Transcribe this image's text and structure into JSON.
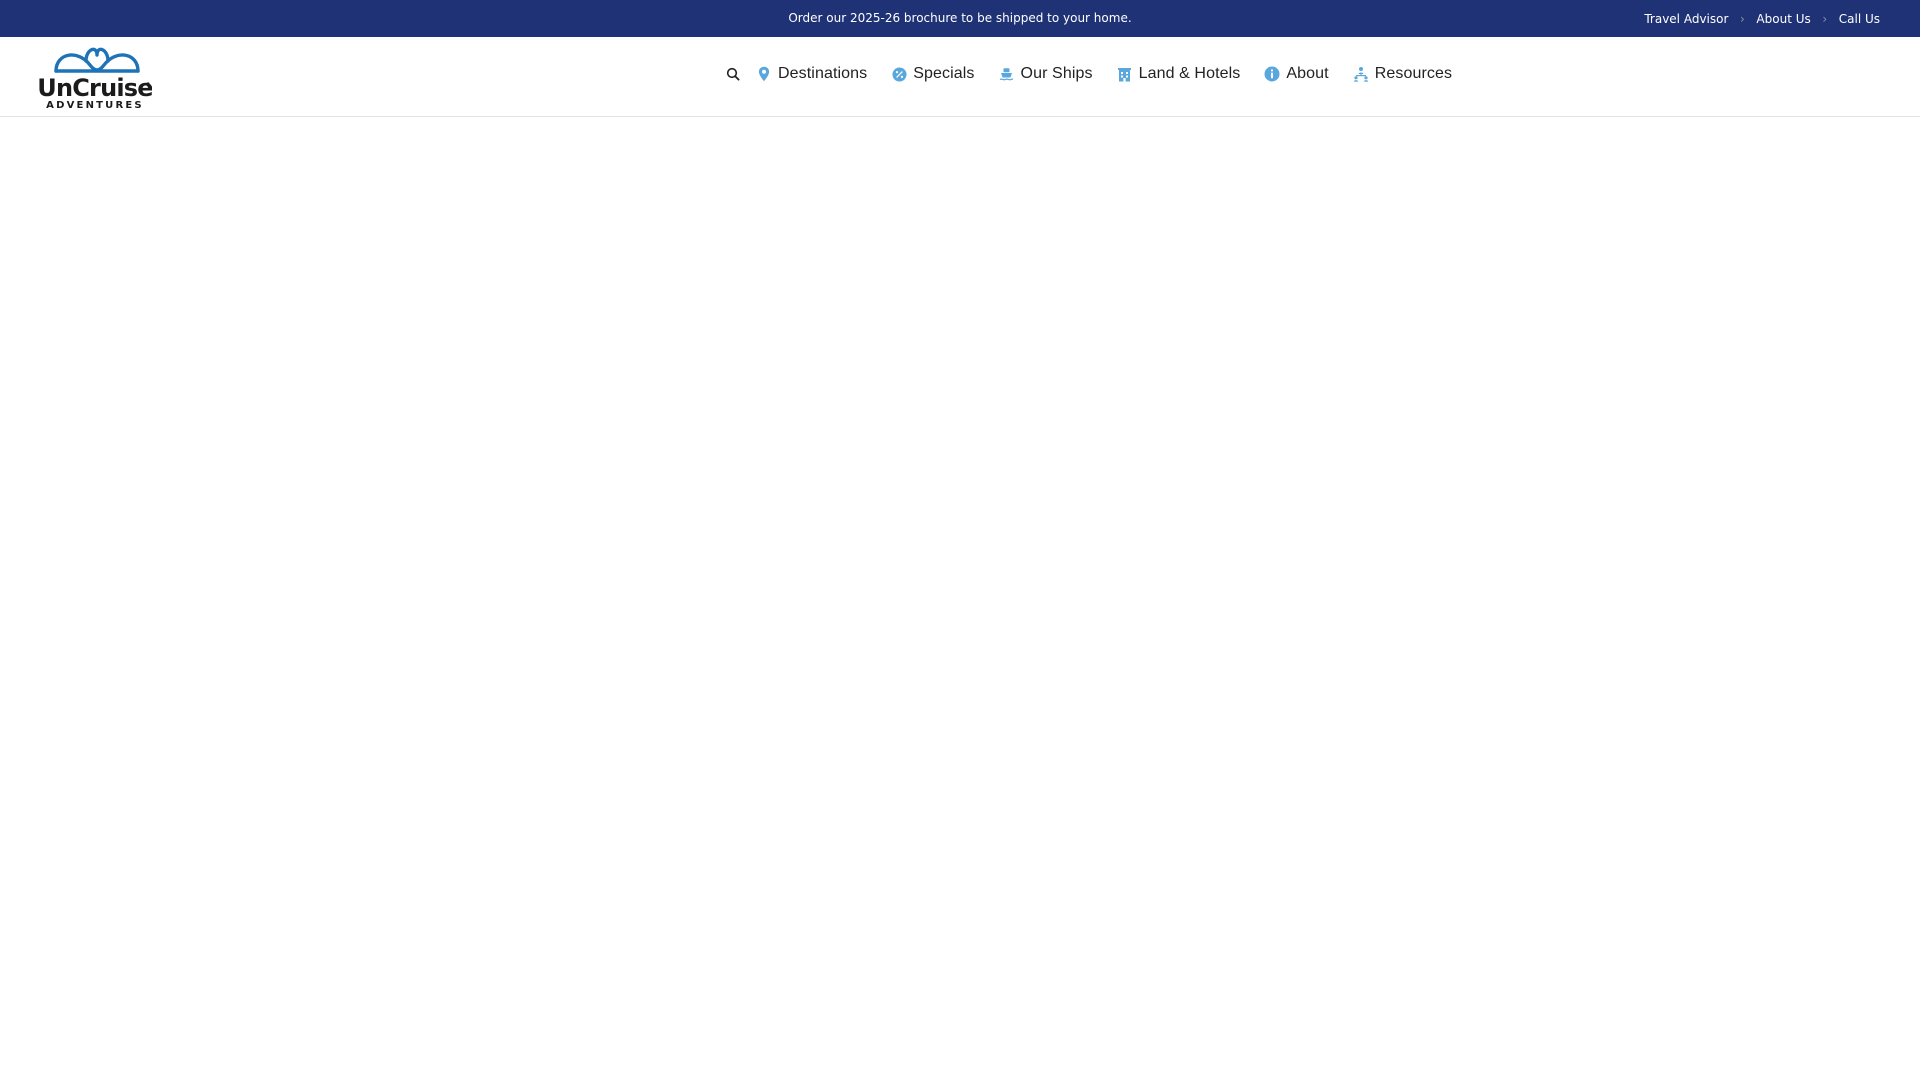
{
  "topbar": {
    "promo": "Order our 2025-26 brochure to be shipped to your home.",
    "links": [
      "Travel Advisor",
      "About Us",
      "Call Us"
    ],
    "separator": "›",
    "background": "#1f3275"
  },
  "logo": {
    "brand": "UnCruise",
    "tagline": "ADVENTURES",
    "color": "#1e73b8"
  },
  "nav": {
    "search_icon": "search-icon",
    "items": [
      {
        "label": "Destinations",
        "icon": "map-pin-icon"
      },
      {
        "label": "Specials",
        "icon": "percent-badge-icon"
      },
      {
        "label": "Our Ships",
        "icon": "ship-icon"
      },
      {
        "label": "Land & Hotels",
        "icon": "hotel-icon"
      },
      {
        "label": "About",
        "icon": "info-icon"
      },
      {
        "label": "Resources",
        "icon": "people-network-icon"
      }
    ],
    "icon_color": "#5aa7de"
  }
}
